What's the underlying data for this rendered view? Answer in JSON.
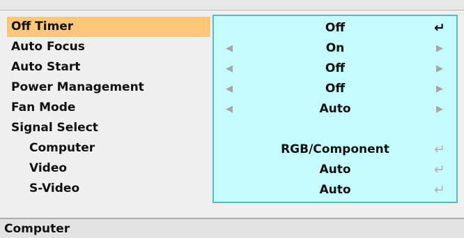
{
  "menu": {
    "items": [
      {
        "label": "Off Timer",
        "value": "Off",
        "left_arrow": "",
        "right_arrow": "",
        "enter": "↵"
      },
      {
        "label": "Auto Focus",
        "value": "On",
        "left_arrow": "◀",
        "right_arrow": "▶",
        "enter": ""
      },
      {
        "label": "Auto Start",
        "value": "Off",
        "left_arrow": "◀",
        "right_arrow": "▶",
        "enter": ""
      },
      {
        "label": "Power Management",
        "value": "Off",
        "left_arrow": "◀",
        "right_arrow": "▶",
        "enter": ""
      },
      {
        "label": "Fan Mode",
        "value": "Auto",
        "left_arrow": "◀",
        "right_arrow": "▶",
        "enter": ""
      },
      {
        "label": "Signal Select",
        "value": "",
        "left_arrow": "",
        "right_arrow": "",
        "enter": ""
      },
      {
        "label": "Computer",
        "value": "RGB/Component",
        "left_arrow": "",
        "right_arrow": "",
        "enter": "↵"
      },
      {
        "label": "Video",
        "value": "Auto",
        "left_arrow": "",
        "right_arrow": "",
        "enter": "↵"
      },
      {
        "label": "S-Video",
        "value": "Auto",
        "left_arrow": "",
        "right_arrow": "",
        "enter": "↵"
      }
    ]
  },
  "status": {
    "text": "Computer"
  },
  "colors": {
    "selected_highlight": "#ffc77a",
    "value_panel": "#c6fbfd",
    "value_panel_border": "#58b8c4"
  },
  "icons": {
    "enter": "enter-arrow-icon",
    "left": "left-arrow-icon",
    "right": "right-arrow-icon"
  }
}
